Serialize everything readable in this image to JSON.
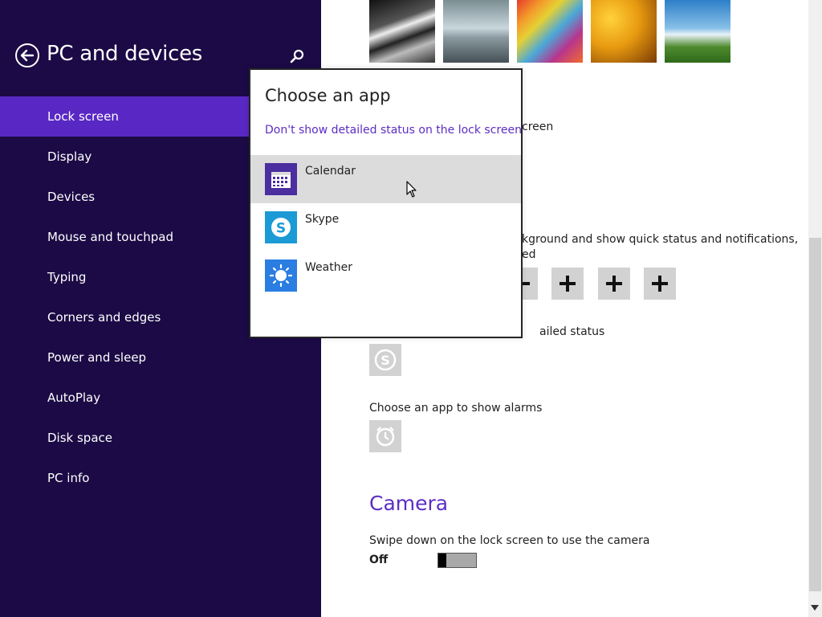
{
  "colors": {
    "sidebar_bg": "#1b0a45",
    "sidebar_active": "#5928c4",
    "accent": "#5b2dc4",
    "tile_gray": "#d2d2d2",
    "calendar_icon_bg": "#4b2e9f",
    "skype_icon_bg": "#1b9ad6",
    "weather_icon_bg": "#2a7de1"
  },
  "sidebar": {
    "title": "PC and devices",
    "back_icon": "back-arrow-icon",
    "search_icon": "search-icon",
    "items": [
      {
        "label": "Lock screen",
        "active": true
      },
      {
        "label": "Display",
        "active": false
      },
      {
        "label": "Devices",
        "active": false
      },
      {
        "label": "Mouse and touchpad",
        "active": false
      },
      {
        "label": "Typing",
        "active": false
      },
      {
        "label": "Corners and edges",
        "active": false
      },
      {
        "label": "Power and sleep",
        "active": false
      },
      {
        "label": "AutoPlay",
        "active": false
      },
      {
        "label": "Disk space",
        "active": false
      },
      {
        "label": "PC info",
        "active": false
      }
    ]
  },
  "main": {
    "peek_text_1": "creen",
    "peek_text_2a": "kground and show quick status and notifications,",
    "peek_text_2b": "ed",
    "peek_text_3": "ailed status",
    "alarms_label": "Choose an app to show alarms",
    "detailed_status_app_icon": "skype-icon",
    "alarm_app_icon": "alarm-clock-icon",
    "camera_heading": "Camera",
    "camera_description": "Swipe down on the lock screen to use the camera",
    "camera_toggle_state": "Off"
  },
  "popup": {
    "title": "Choose an app",
    "link": "Don't show detailed status on the lock screen",
    "apps": [
      {
        "label": "Calendar",
        "icon": "calendar-icon",
        "hover": true
      },
      {
        "label": "Skype",
        "icon": "skype-icon",
        "hover": false
      },
      {
        "label": "Weather",
        "icon": "weather-sun-icon",
        "hover": false
      }
    ]
  }
}
